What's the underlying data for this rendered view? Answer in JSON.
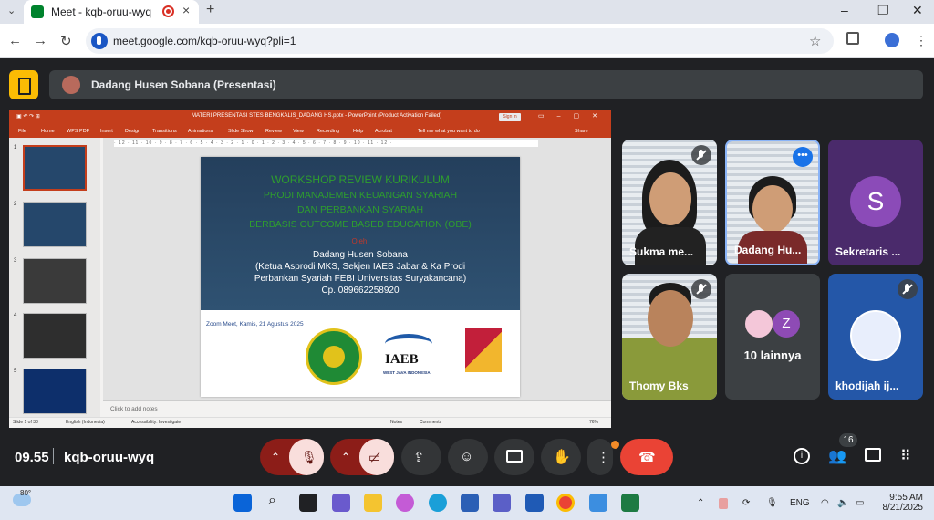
{
  "browser": {
    "tab_title": "Meet - kqb-oruu-wyq",
    "url": "meet.google.com/kqb-oruu-wyq?pli=1",
    "window_controls": [
      "–",
      "❐",
      "✕"
    ]
  },
  "presenter": {
    "banner": "Dadang Husen Sobana (Presentasi)"
  },
  "ppt": {
    "title": "MATERI PRESENTASI STES BENGKALIS_DADANG HS.pptx - PowerPoint (Product Activation Failed)",
    "sign_in": "Sign in",
    "tabs": [
      "File",
      "Home",
      "WPS PDF",
      "Insert",
      "Design",
      "Transitions",
      "Animations",
      "Slide Show",
      "Review",
      "View",
      "Recording",
      "Help",
      "Acrobat",
      "Tell me what you want to do"
    ],
    "share": "Share",
    "ruler": "· 12 · 11 · 10 · 9 · 8 · 7 · 6 · 5 · 4 · 3 · 2 · 1 · 0 · 1 · 2 · 3 · 4 · 5 · 6 · 7 · 8 · 9 · 10 · 11 · 12 ·",
    "slide_numbers": [
      "1",
      "2",
      "3",
      "4",
      "5"
    ],
    "slide": {
      "line1": "WORKSHOP REVIEW KURIKULUM",
      "line2": "PRODI MANAJEMEN KEUANGAN SYARIAH",
      "line3": "DAN PERBANKAN SYARIAH",
      "line4": "BERBASIS OUTCOME BASED EDUCATION (OBE)",
      "by": "Oleh:",
      "name": "Dadang Husen Sobana",
      "role1": "(Ketua Asprodi MKS, Sekjen IAEB Jabar & Ka Prodi",
      "role2": "Perbankan Syariah FEBI Universitas Suryakancana)",
      "phone": "Cp. 089662258920",
      "zoom": "Zoom Meet, Kamis, 21 Agustus 2025",
      "logo_iaeb": "IAEB",
      "logo_iaeb_sub": "WEST JAVA INDONESIA"
    },
    "notes": "Click to add notes",
    "status_slide": "Slide 1 of 38",
    "status_lang": "English (Indonesia)",
    "status_access": "Accessibility: Investigate",
    "status_notes": "Notes",
    "status_comments": "Comments",
    "status_zoom": "76%"
  },
  "participants": [
    {
      "name": "Sukma me..."
    },
    {
      "name": "Dadang Hu..."
    },
    {
      "name": "Sekretaris ...",
      "initial": "S"
    },
    {
      "name": "Thomy Bks"
    },
    {
      "name": "10 lainnya",
      "initial": "Z"
    },
    {
      "name": "khodijah ij..."
    }
  ],
  "meeting": {
    "time": "09.55",
    "code": "kqb-oruu-wyq",
    "participant_count": "16"
  },
  "taskbar": {
    "temp": "80°",
    "lang": "ENG",
    "time": "9:55 AM",
    "date": "8/21/2025"
  },
  "colors": {
    "meet_bg": "#202124",
    "ppt_accent": "#c43e1c",
    "end_call": "#ea4335",
    "muted": "#f9dedc"
  }
}
